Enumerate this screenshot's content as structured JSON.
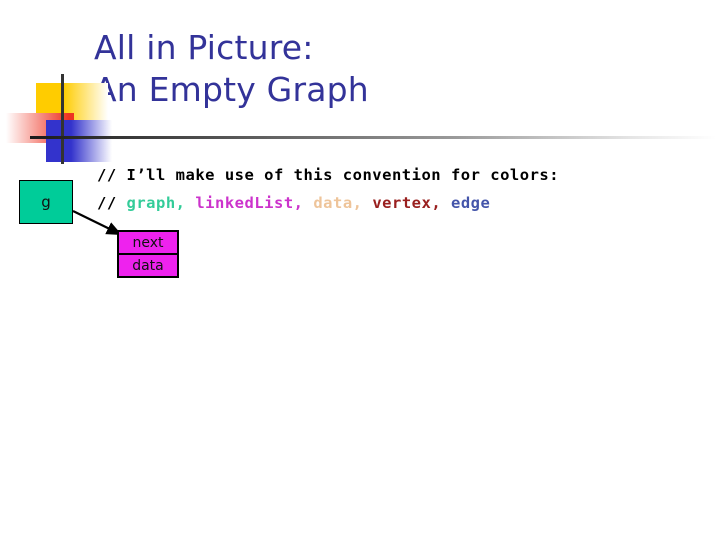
{
  "slide": {
    "title": "All in Picture:\nAn Empty Graph",
    "title_color": "#333399"
  },
  "decor": {
    "yellow_color": "#FFCC00",
    "red_color": "#EE3322",
    "blue_color": "#3333CC",
    "line_color": "#333333"
  },
  "code": {
    "line1": "// I’ll make use of this convention for colors:",
    "line2_prefix": "// ",
    "tokens": [
      {
        "text": "graph",
        "color": "#33CC99"
      },
      {
        "text": "linkedList",
        "color": "#CC33CC"
      },
      {
        "text": "data",
        "color": "#EEC49A"
      },
      {
        "text": "vertex",
        "color": "#99201F"
      },
      {
        "text": "edge",
        "color": "#4455AA"
      }
    ],
    "separator": ", ",
    "default_color": "#000000"
  },
  "diagram": {
    "graph_node": {
      "label": "g",
      "fill": "#00CC99"
    },
    "list_node": {
      "fill": "#EE22EE",
      "cells": [
        {
          "label": "next"
        },
        {
          "label": "data"
        }
      ]
    },
    "arrow": {
      "from": "g",
      "to": "list_node",
      "color": "#000000"
    }
  }
}
